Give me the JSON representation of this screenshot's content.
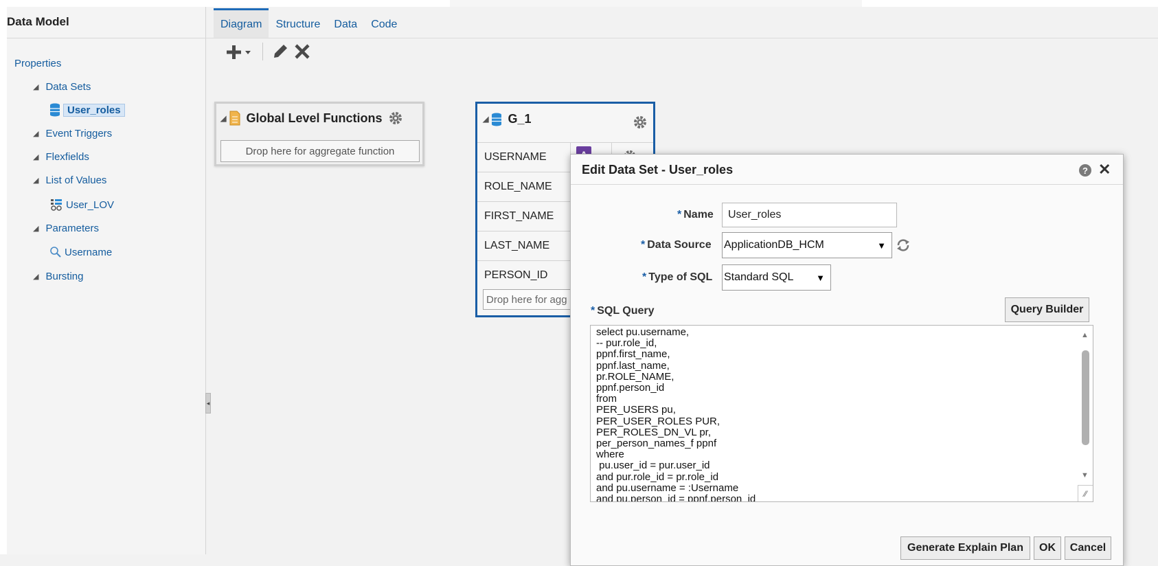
{
  "left_panel": {
    "title": "Data Model",
    "items": [
      {
        "label": "Properties"
      },
      {
        "label": "Data Sets"
      },
      {
        "label": "User_roles"
      },
      {
        "label": "Event Triggers"
      },
      {
        "label": "Flexfields"
      },
      {
        "label": "List of Values"
      },
      {
        "label": "User_LOV"
      },
      {
        "label": "Parameters"
      },
      {
        "label": "Username"
      },
      {
        "label": "Bursting"
      }
    ]
  },
  "tabs": [
    "Diagram",
    "Structure",
    "Data",
    "Code"
  ],
  "active_tab": "Diagram",
  "toolbar": {
    "icons": [
      "add-icon",
      "edit-icon",
      "delete-icon"
    ]
  },
  "global_functions": {
    "title": "Global Level Functions",
    "drop_text": "Drop here for aggregate function"
  },
  "group": {
    "title": "G_1",
    "columns": [
      "USERNAME",
      "ROLE_NAME",
      "FIRST_NAME",
      "LAST_NAME",
      "PERSON_ID"
    ],
    "type_badge": "A",
    "drop_text": "Drop here for agg"
  },
  "dialog": {
    "title": "Edit Data Set - User_roles",
    "help_label": "?",
    "close_label": "✕",
    "required_marker": "*",
    "name_label": "Name",
    "name_value": "User_roles",
    "data_source_label": "Data Source",
    "data_source_value": "ApplicationDB_HCM",
    "type_sql_label": "Type of SQL",
    "type_sql_value": "Standard SQL",
    "sql_query_label": "SQL Query",
    "query_builder": "Query Builder",
    "sql_lines": [
      "select pu.username,",
      "-- pur.role_id,",
      "ppnf.first_name,",
      "ppnf.last_name,",
      "pr.ROLE_NAME,",
      "ppnf.person_id",
      "from",
      "PER_USERS pu,",
      "PER_USER_ROLES PUR,",
      "PER_ROLES_DN_VL pr,",
      "per_person_names_f ppnf",
      "where",
      " pu.user_id = pur.user_id",
      "and pur.role_id = pr.role_id",
      "and pu.username = :Username",
      "and pu.person_id = ppnf.person_id"
    ],
    "buttons": {
      "explain": "Generate Explain Plan",
      "ok": "OK",
      "cancel": "Cancel"
    }
  },
  "colors": {
    "accent": "#1a5ea6",
    "link": "#145c9e",
    "badge": "#6b3fa0"
  }
}
